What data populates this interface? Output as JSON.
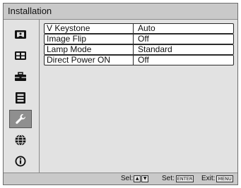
{
  "header": {
    "title": "Installation"
  },
  "sidebar": {
    "items": [
      {
        "icon": "picture-icon",
        "selected": false
      },
      {
        "icon": "screen-icon",
        "selected": false
      },
      {
        "icon": "toolbox-icon",
        "selected": false
      },
      {
        "icon": "menu-list-icon",
        "selected": false
      },
      {
        "icon": "wrench-icon",
        "selected": true
      },
      {
        "icon": "globe-icon",
        "selected": false
      },
      {
        "icon": "info-icon",
        "selected": false
      }
    ]
  },
  "settings": [
    {
      "label": "V Keystone",
      "value": "Auto"
    },
    {
      "label": "Image Flip",
      "value": "Off"
    },
    {
      "label": "Lamp Mode",
      "value": "Standard"
    },
    {
      "label": "Direct Power ON",
      "value": "Off"
    }
  ],
  "footer": {
    "sel_label": "Sel:",
    "sel_up": "▲",
    "sel_down": "▼",
    "set_label": "Set:",
    "set_key": "ENTER",
    "exit_label": "Exit:",
    "exit_key": "MENU"
  }
}
